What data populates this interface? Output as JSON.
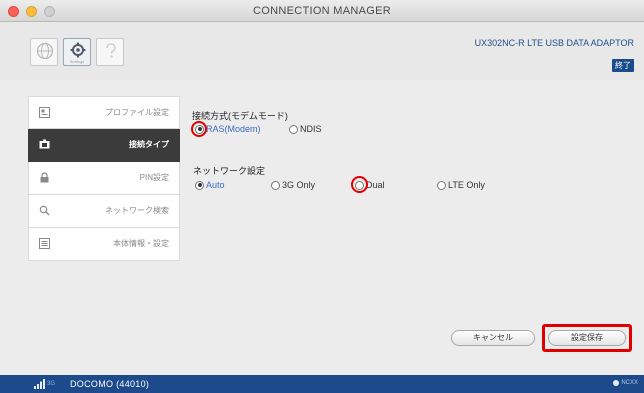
{
  "window": {
    "title": "CONNECTION MANAGER"
  },
  "toolbar": {
    "settings_label": "Settings",
    "device_name": "UX302NC-R LTE USB DATA ADAPTOR",
    "exit_label": "終了"
  },
  "sidebar": {
    "items": [
      {
        "label": "プロファイル設定",
        "icon": "profile-icon"
      },
      {
        "label": "接続タイプ",
        "icon": "connection-type-icon",
        "active": true
      },
      {
        "label": "PIN設定",
        "icon": "lock-icon"
      },
      {
        "label": "ネットワーク検索",
        "icon": "search-icon"
      },
      {
        "label": "本体情報・設定",
        "icon": "device-info-icon"
      }
    ]
  },
  "connection": {
    "heading": "接続方式(モデムモード)",
    "options": [
      {
        "label": "RAS(Modem)",
        "selected": true
      },
      {
        "label": "NDIS",
        "selected": false
      }
    ]
  },
  "network": {
    "heading": "ネットワーク設定",
    "options": [
      {
        "label": "Auto",
        "selected": true
      },
      {
        "label": "3G Only",
        "selected": false
      },
      {
        "label": "Dual",
        "selected": false
      },
      {
        "label": "LTE Only",
        "selected": false
      }
    ]
  },
  "buttons": {
    "cancel": "キャンセル",
    "save": "設定保存"
  },
  "status": {
    "network_type": "3G",
    "carrier": "DOCOMO (44010)",
    "brand": "NCXX"
  },
  "colors": {
    "accent": "#1c4a8b",
    "highlight": "#e00000",
    "selected_text": "#3a6cc4"
  }
}
